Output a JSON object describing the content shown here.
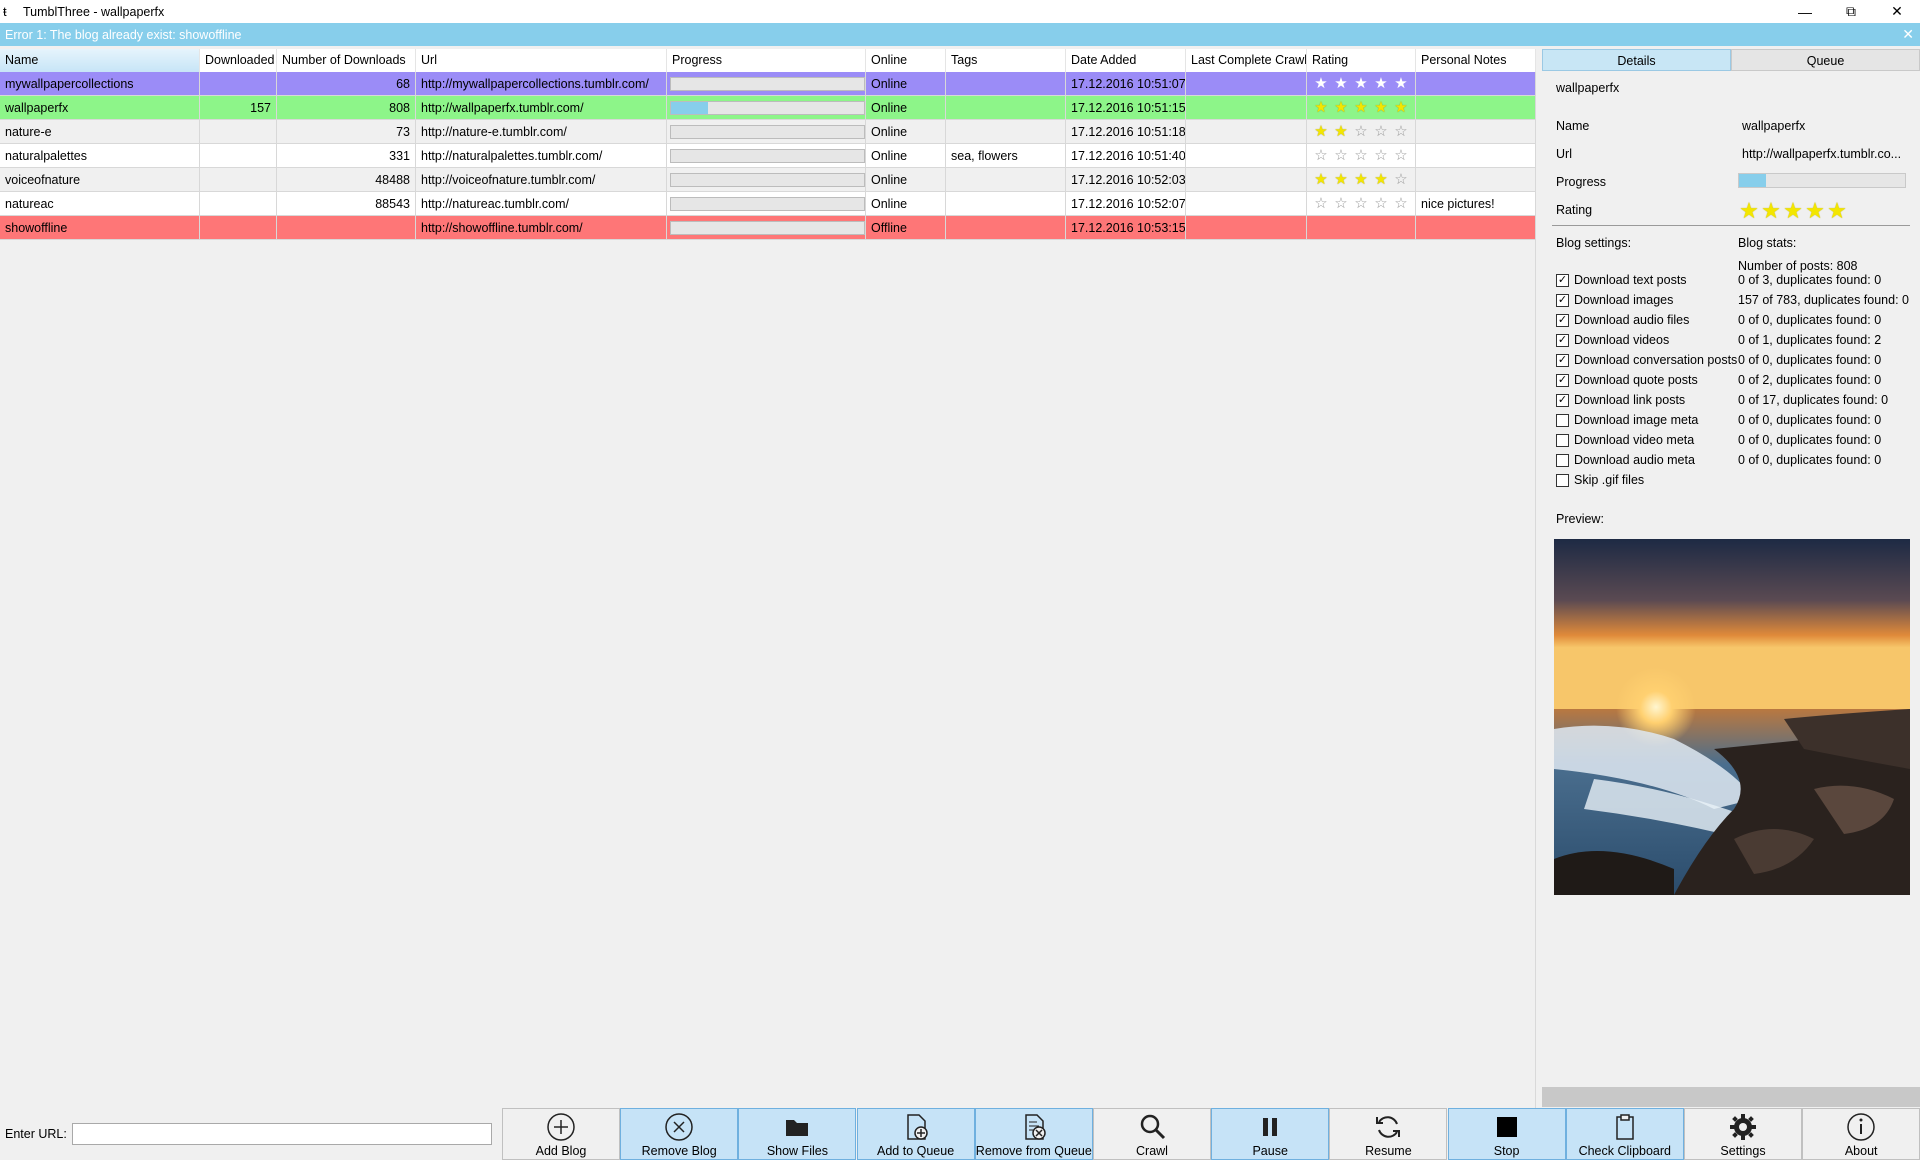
{
  "window": {
    "title": "TumblThree - wallpaperfx"
  },
  "error": {
    "message": "Error 1: The blog already exist:  showoffline"
  },
  "grid": {
    "columns": [
      "Name",
      "Downloaded",
      "Number of Downloads",
      "Url",
      "Progress",
      "Online",
      "Tags",
      "Date Added",
      "Last Complete Crawl",
      "Rating",
      "Personal Notes"
    ],
    "rows": [
      {
        "name": "mywallpapercollections",
        "downloaded": "",
        "number": "68",
        "url": "http://mywallpapercollections.tumblr.com/",
        "progress": 0,
        "online": "Online",
        "tags": "",
        "date": "17.12.2016 10:51:07",
        "last": "",
        "rating": 5,
        "notes": "",
        "color": "#9b8cf7"
      },
      {
        "name": "wallpaperfx",
        "downloaded": "157",
        "number": "808",
        "url": "http://wallpaperfx.tumblr.com/",
        "progress": 0.19,
        "online": "Online",
        "tags": "",
        "date": "17.12.2016 10:51:15",
        "last": "",
        "rating": 5,
        "notes": "",
        "color": "#8df589"
      },
      {
        "name": "nature-e",
        "downloaded": "",
        "number": "73",
        "url": "http://nature-e.tumblr.com/",
        "progress": 0,
        "online": "Online",
        "tags": "",
        "date": "17.12.2016 10:51:18",
        "last": "",
        "rating": 2,
        "notes": "",
        "color": "#f0f0f0"
      },
      {
        "name": "naturalpalettes",
        "downloaded": "",
        "number": "331",
        "url": "http://naturalpalettes.tumblr.com/",
        "progress": 0,
        "online": "Online",
        "tags": "sea, flowers",
        "date": "17.12.2016 10:51:40",
        "last": "",
        "rating": 0,
        "notes": "",
        "color": "#ffffff"
      },
      {
        "name": "voiceofnature",
        "downloaded": "",
        "number": "48488",
        "url": "http://voiceofnature.tumblr.com/",
        "progress": 0,
        "online": "Online",
        "tags": "",
        "date": "17.12.2016 10:52:03",
        "last": "",
        "rating": 4,
        "notes": "",
        "color": "#f0f0f0"
      },
      {
        "name": "natureac",
        "downloaded": "",
        "number": "88543",
        "url": "http://natureac.tumblr.com/",
        "progress": 0,
        "online": "Online",
        "tags": "",
        "date": "17.12.2016 10:52:07",
        "last": "",
        "rating": 0,
        "notes": "nice pictures!",
        "color": "#ffffff"
      },
      {
        "name": "showoffline",
        "downloaded": "",
        "number": "",
        "url": "http://showoffline.tumblr.com/",
        "progress": 0,
        "online": "Offline",
        "tags": "",
        "date": "17.12.2016 10:53:15",
        "last": "",
        "rating": null,
        "notes": "",
        "color": "#fe7677"
      }
    ]
  },
  "panel": {
    "tabs": [
      "Details",
      "Queue"
    ],
    "blog_title": "wallpaperfx",
    "name_label": "Name",
    "name_value": "wallpaperfx",
    "url_label": "Url",
    "url_value": "http://wallpaperfx.tumblr.co...",
    "progress_label": "Progress",
    "progress_value": 0.16,
    "rating_label": "Rating",
    "rating_value": 5,
    "settings_label": "Blog settings:",
    "stats_label": "Blog stats:",
    "posts_label": "Number of posts:  808",
    "settings": [
      {
        "label": "Download text posts",
        "checked": true,
        "stat": "0 of 3, duplicates found: 0"
      },
      {
        "label": "Download images",
        "checked": true,
        "stat": "157 of 783, duplicates found: 0"
      },
      {
        "label": "Download audio files",
        "checked": true,
        "stat": "0 of 0, duplicates found: 0"
      },
      {
        "label": "Download videos",
        "checked": true,
        "stat": "0 of 1, duplicates found: 2"
      },
      {
        "label": "Download conversation posts",
        "checked": true,
        "stat": "0 of 0, duplicates found: 0"
      },
      {
        "label": "Download quote posts",
        "checked": true,
        "stat": "0 of 2, duplicates found: 0"
      },
      {
        "label": "Download link posts",
        "checked": true,
        "stat": "0 of 17, duplicates found: 0"
      },
      {
        "label": "Download image meta",
        "checked": false,
        "stat": "0 of 0, duplicates found: 0"
      },
      {
        "label": "Download video meta",
        "checked": false,
        "stat": "0 of 0, duplicates found: 0"
      },
      {
        "label": "Download audio meta",
        "checked": false,
        "stat": "0 of 0, duplicates found: 0"
      },
      {
        "label": "Skip .gif files",
        "checked": false,
        "stat": ""
      }
    ],
    "preview_label": "Preview:"
  },
  "bottom": {
    "url_label": "Enter URL:",
    "url_value": "",
    "buttons": [
      {
        "label": "Add Blog",
        "icon": "plus-circle-icon",
        "highlight": false
      },
      {
        "label": "Remove Blog",
        "icon": "x-circle-icon",
        "highlight": true
      },
      {
        "label": "Show Files",
        "icon": "folder-icon",
        "highlight": true
      },
      {
        "label": "Add to Queue",
        "icon": "document-plus-icon",
        "highlight": true
      },
      {
        "label": "Remove from Queue",
        "icon": "document-remove-icon",
        "highlight": true
      },
      {
        "label": "Crawl",
        "icon": "magnifier-icon",
        "highlight": false
      },
      {
        "label": "Pause",
        "icon": "pause-icon",
        "highlight": true
      },
      {
        "label": "Resume",
        "icon": "refresh-icon",
        "highlight": false
      },
      {
        "label": "Stop",
        "icon": "stop-icon",
        "highlight": true
      },
      {
        "label": "Check Clipboard",
        "icon": "clipboard-icon",
        "highlight": true
      },
      {
        "label": "Settings",
        "icon": "gear-icon",
        "highlight": false
      },
      {
        "label": "About",
        "icon": "info-icon",
        "highlight": false
      }
    ]
  },
  "colors": {
    "accent": "#87ceeb",
    "star": "#f3e600"
  }
}
